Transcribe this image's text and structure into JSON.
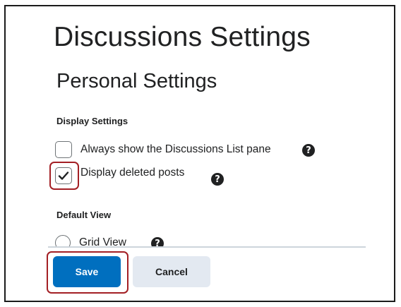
{
  "page": {
    "title": "Discussions Settings"
  },
  "personal_settings": {
    "title": "Personal Settings",
    "display_settings": {
      "label": "Display Settings",
      "options": [
        {
          "label": "Always show the Discussions List pane",
          "checked": false,
          "help_icon": "question-circle-icon"
        },
        {
          "label": "Display deleted posts",
          "checked": true,
          "help_icon": "question-circle-icon"
        }
      ]
    },
    "default_view": {
      "label": "Default View",
      "options": [
        {
          "label": "Grid View",
          "selected": false,
          "help_icon": "question-circle-icon"
        }
      ]
    }
  },
  "footer": {
    "save_label": "Save",
    "cancel_label": "Cancel"
  },
  "colors": {
    "primary": "#006fbf",
    "highlight": "#a31f24",
    "secondary_button": "#e3e9f1"
  }
}
